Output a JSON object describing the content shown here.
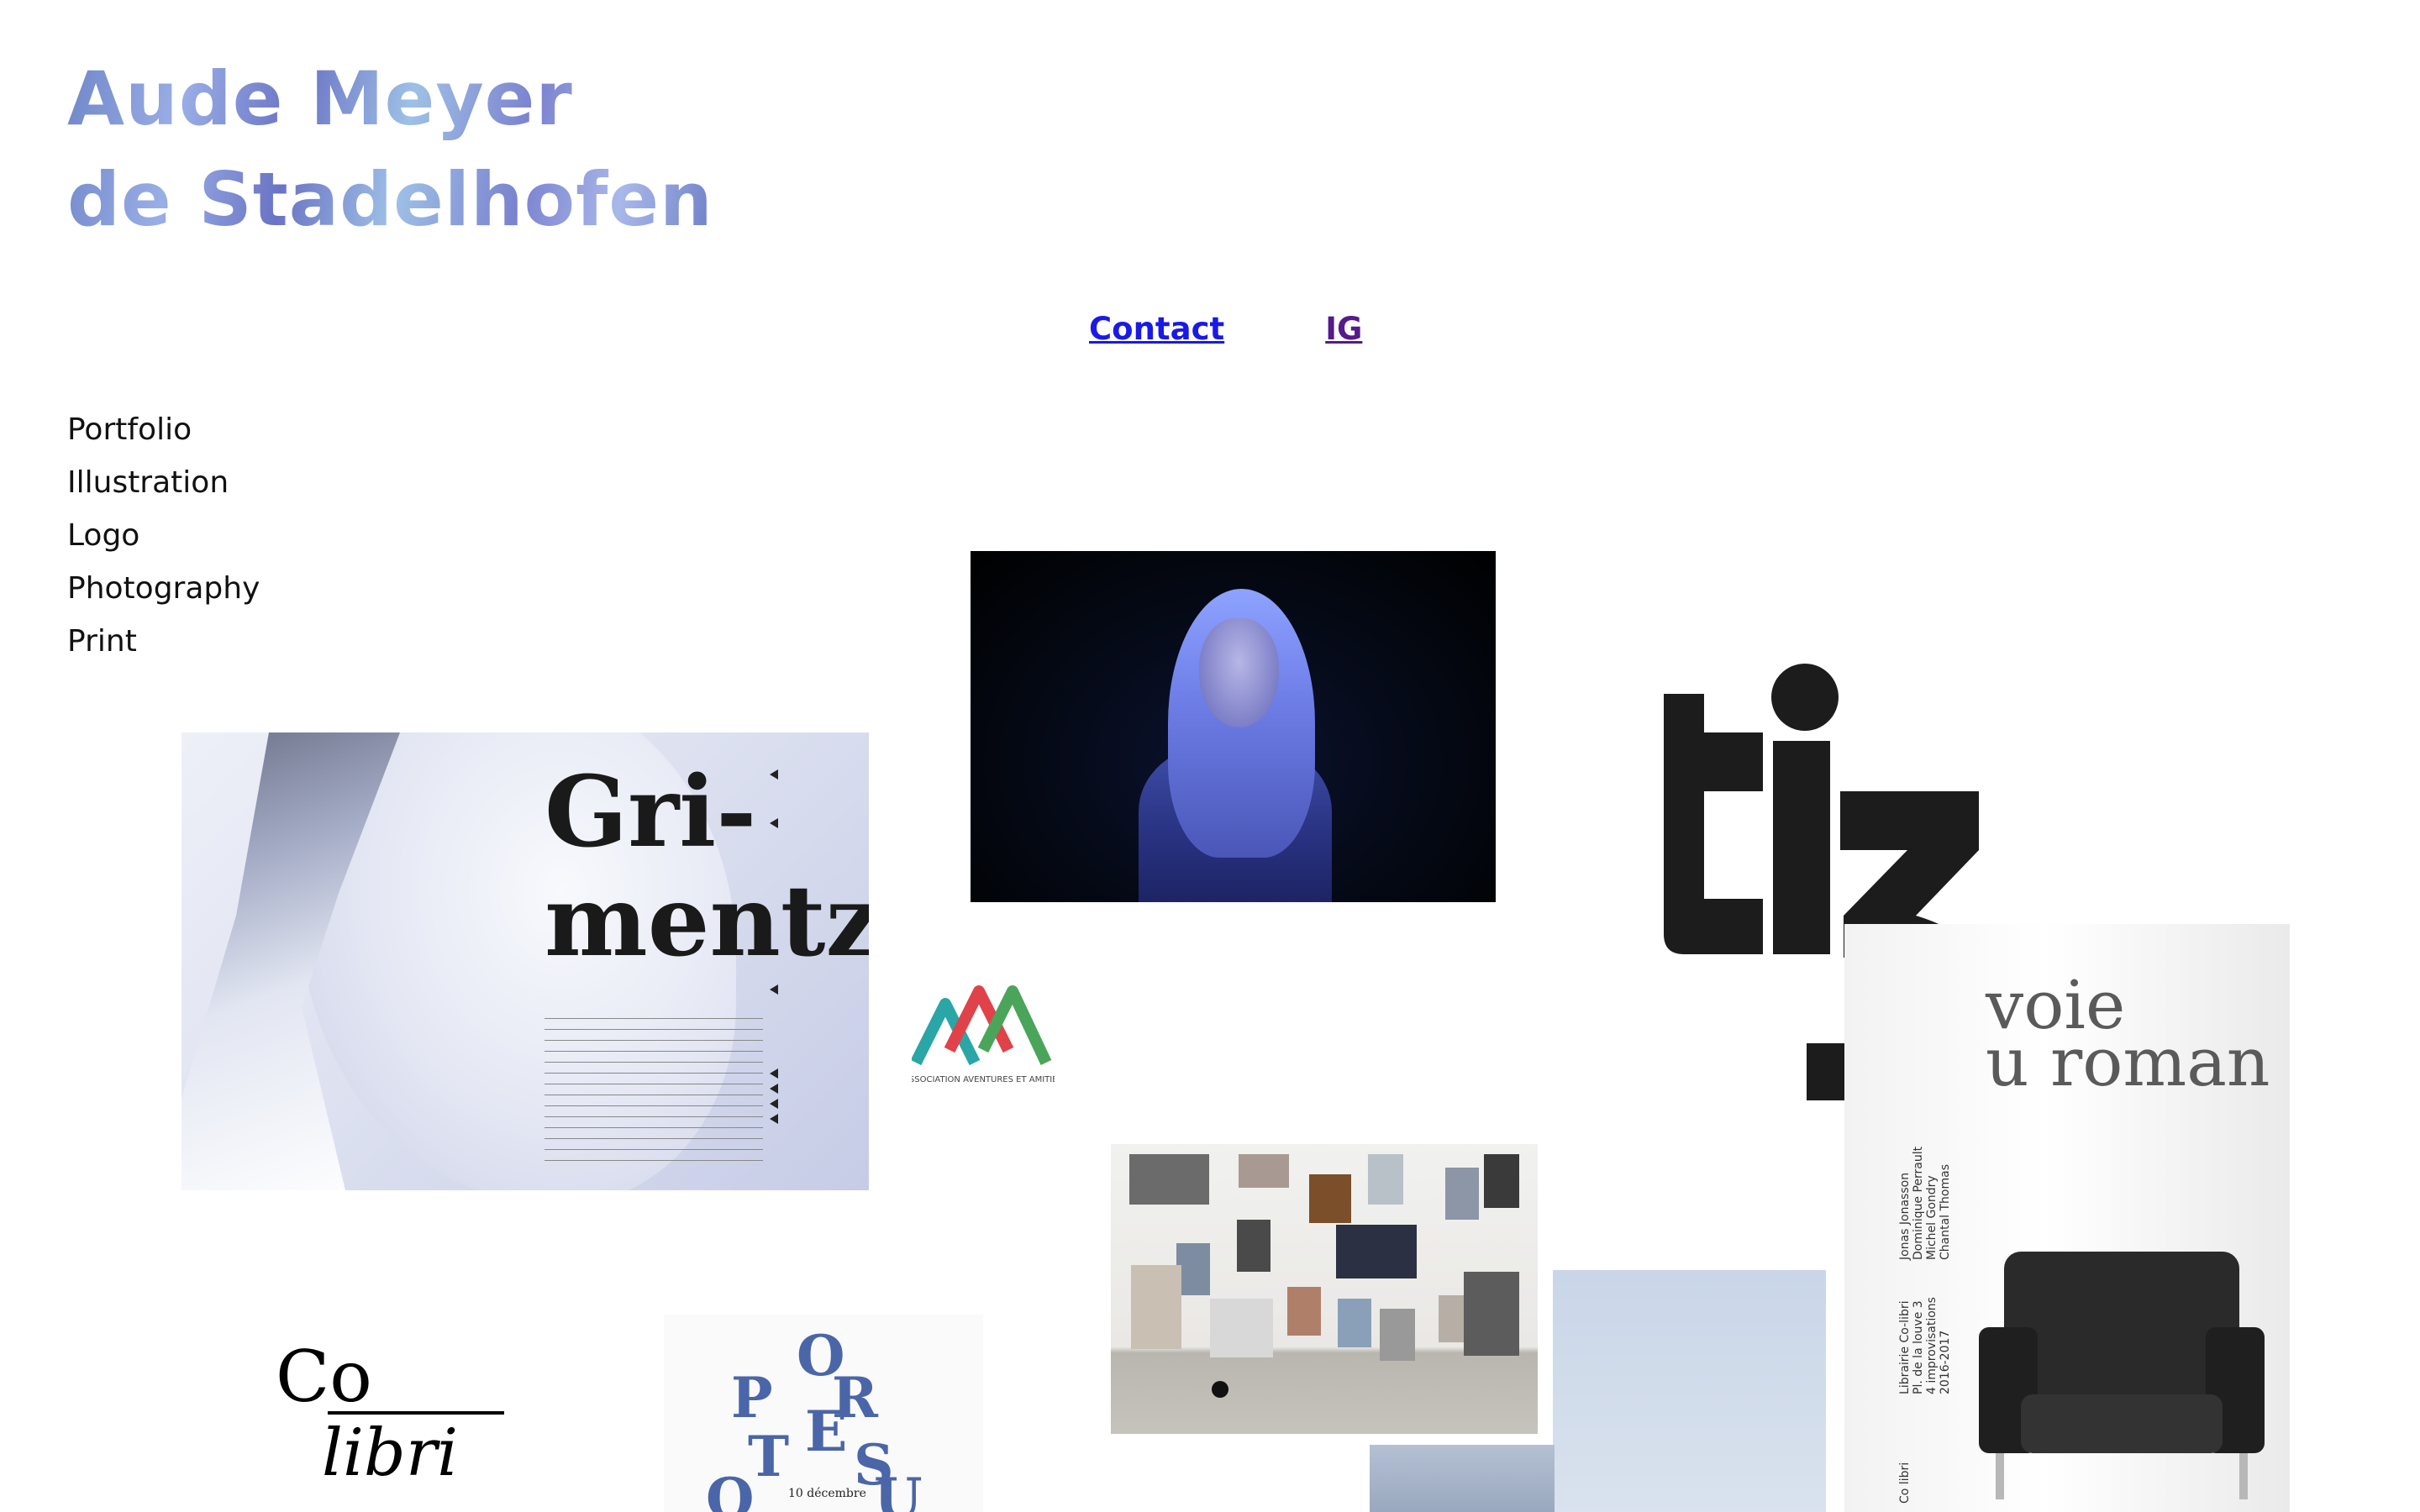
{
  "site": {
    "title_line1": "Aude Meyer",
    "title_line2": "de Stadelhofen"
  },
  "top_links": {
    "contact": "Contact",
    "ig": "IG"
  },
  "nav": {
    "items": [
      {
        "label": "Portfolio"
      },
      {
        "label": "Illustration"
      },
      {
        "label": "Logo"
      },
      {
        "label": "Photography"
      },
      {
        "label": "Print"
      }
    ]
  },
  "tiles": {
    "grimentz": {
      "word_line1": "Gri-",
      "word_line2": "mentz"
    },
    "aaa": {
      "caption": "ASSOCIATION AVENTURES ET AMITIÉS"
    },
    "voie_roman": {
      "line1": "voie",
      "line2": "u roman",
      "names": "Jonas Jonasson\nDominique Perrault\nMichel Gondry\nChantal Thomas",
      "venue": "Librairie Co-libri\nPl. de la louve 3\n4 improvisations\n2016-2017",
      "brand": "Co libri"
    },
    "colibri": {
      "co": "Co",
      "libri": "libri"
    },
    "poetry": {
      "date": "10 décembre"
    }
  },
  "colors": {
    "link_contact": "#1a1ae6",
    "link_ig": "#551a8b",
    "logo_dark": "#1c1c1c",
    "aaa_teal": "#2aa6a6",
    "aaa_red": "#e0424a",
    "aaa_green": "#4aa55a",
    "poetry_blue": "#4a66a8"
  }
}
